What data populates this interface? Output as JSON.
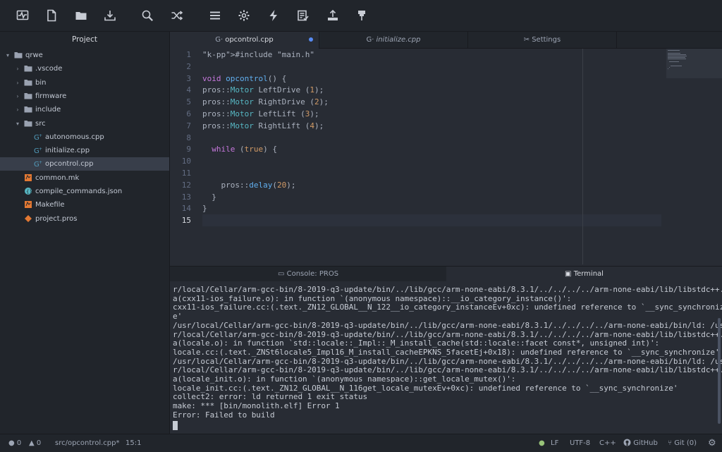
{
  "toolbar": {
    "icons": [
      "activity-monitor-icon",
      "new-file-icon",
      "open-folder-icon",
      "download-icon",
      "search-icon",
      "shuffle-icon",
      "menu-icon",
      "settings-icon",
      "lightning-icon",
      "checklist-icon",
      "upload-icon",
      "pros-terminal-icon"
    ]
  },
  "sidebar": {
    "title": "Project",
    "tree": [
      {
        "label": "qrwe",
        "kind": "folder-open"
      },
      {
        "label": ".vscode",
        "kind": "folder"
      },
      {
        "label": "bin",
        "kind": "folder"
      },
      {
        "label": "firmware",
        "kind": "folder"
      },
      {
        "label": "include",
        "kind": "folder"
      },
      {
        "label": "src",
        "kind": "folder-open"
      },
      {
        "label": "autonomous.cpp",
        "kind": "cpp"
      },
      {
        "label": "initialize.cpp",
        "kind": "cpp"
      },
      {
        "label": "opcontrol.cpp",
        "kind": "cpp",
        "selected": true
      },
      {
        "label": "common.mk",
        "kind": "make"
      },
      {
        "label": "compile_commands.json",
        "kind": "json"
      },
      {
        "label": "Makefile",
        "kind": "make"
      },
      {
        "label": "project.pros",
        "kind": "pros"
      }
    ]
  },
  "tabs": [
    {
      "label": "opcontrol.cpp",
      "active": true,
      "modified": true
    },
    {
      "label": "initialize.cpp",
      "active": false
    },
    {
      "label": "Settings",
      "active": false
    }
  ],
  "editor": {
    "current_line": 15,
    "lines": [
      "#include \"main.h\"",
      "",
      "void opcontrol() {",
      "pros::Motor LeftDrive (1);",
      "pros::Motor RightDrive (2);",
      "pros::Motor LeftLift (3);",
      "pros::Motor RightLift (4);",
      "",
      "  while (true) {",
      "",
      "",
      "    pros::delay(20);",
      "  }",
      "}",
      ""
    ]
  },
  "panel": {
    "tabs": [
      {
        "label": "Console: PROS",
        "active": false
      },
      {
        "label": "Terminal",
        "active": true
      }
    ],
    "terminal_lines": [
      "r/local/Cellar/arm-gcc-bin/8-2019-q3-update/bin/../lib/gcc/arm-none-eabi/8.3.1/../../../../arm-none-eabi/lib/libstdc++.",
      "a(cxx11-ios_failure.o): in function `(anonymous namespace)::__io_category_instance()':",
      "cxx11-ios_failure.cc:(.text._ZN12_GLOBAL__N_122__io_category_instanceEv+0xc): undefined reference to `__sync_synchronize",
      "e'",
      "/usr/local/Cellar/arm-gcc-bin/8-2019-q3-update/bin/../lib/gcc/arm-none-eabi/8.3.1/../../../../arm-none-eabi/bin/ld: /us",
      "r/local/Cellar/arm-gcc-bin/8-2019-q3-update/bin/../lib/gcc/arm-none-eabi/8.3.1/../../../../arm-none-eabi/lib/libstdc++.",
      "a(locale.o): in function `std::locale::_Impl::_M_install_cache(std::locale::facet const*, unsigned int)':",
      "locale.cc:(.text._ZNSt6locale5_Impl16_M_install_cacheEPKNS_5facetEj+0x18): undefined reference to `__sync_synchronize'",
      "/usr/local/Cellar/arm-gcc-bin/8-2019-q3-update/bin/../lib/gcc/arm-none-eabi/8.3.1/../../../../arm-none-eabi/bin/ld: /us",
      "r/local/Cellar/arm-gcc-bin/8-2019-q3-update/bin/../lib/gcc/arm-none-eabi/8.3.1/../../../../arm-none-eabi/lib/libstdc++.",
      "a(locale_init.o): in function `(anonymous namespace)::get_locale_mutex()':",
      "locale_init.cc:(.text._ZN12_GLOBAL__N_116get_locale_mutexEv+0xc): undefined reference to `__sync_synchronize'",
      "collect2: error: ld returned 1 exit status",
      "make: *** [bin/monolith.elf] Error 1",
      "Error: Failed to build"
    ]
  },
  "status": {
    "errors": "0",
    "warnings": "0",
    "file": "src/opcontrol.cpp*",
    "cursor": "15:1",
    "line_ending": "LF",
    "encoding": "UTF-8",
    "grammar": "C++",
    "github": "GitHub",
    "git": "Git (0)"
  },
  "colors": {
    "accent": "#578af2",
    "background": "#282c34",
    "chrome": "#21252b",
    "status_dot": "#98c379"
  }
}
